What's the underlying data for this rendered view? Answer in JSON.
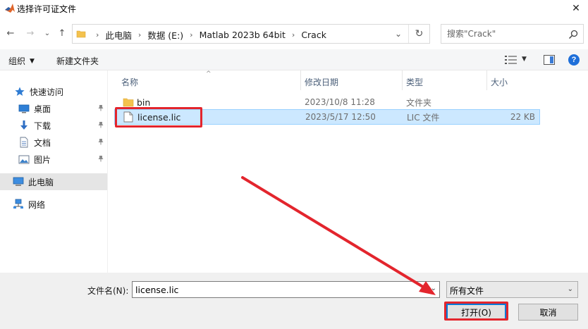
{
  "window": {
    "title": "选择许可证文件",
    "close_glyph": "✕"
  },
  "nav": {
    "back_glyph": "←",
    "forward_glyph": "→",
    "recent_glyph": "⌄",
    "up_glyph": "↑"
  },
  "address": {
    "crumbs": [
      "此电脑",
      "数据 (E:)",
      "Matlab 2023b 64bit",
      "Crack"
    ],
    "separator": "›",
    "dropdown_glyph": "⌄",
    "refresh_glyph": "↻"
  },
  "search": {
    "placeholder": "搜索\"Crack\""
  },
  "toolbar": {
    "organize_label": "组织",
    "organize_caret": "▼",
    "new_folder_label": "新建文件夹",
    "view_caret": "▼",
    "help_glyph": "?"
  },
  "sidebar": {
    "items": [
      {
        "label": "快速访问",
        "icon": "star-icon"
      },
      {
        "label": "桌面",
        "icon": "desktop-icon",
        "pinned": true
      },
      {
        "label": "下载",
        "icon": "download-icon",
        "pinned": true
      },
      {
        "label": "文档",
        "icon": "document-icon",
        "pinned": true
      },
      {
        "label": "图片",
        "icon": "picture-icon",
        "pinned": true
      },
      {
        "label": "此电脑",
        "icon": "computer-icon",
        "selected": true
      },
      {
        "label": "网络",
        "icon": "network-icon"
      }
    ],
    "pin_glyph": "📌"
  },
  "list": {
    "columns": {
      "name": "名称",
      "date": "修改日期",
      "type": "类型",
      "size": "大小"
    },
    "sort_caret": "^",
    "rows": [
      {
        "name": "bin",
        "date": "2023/10/8 11:28",
        "type": "文件夹",
        "size": "",
        "kind": "folder"
      },
      {
        "name": "license.lic",
        "date": "2023/5/17 12:50",
        "type": "LIC 文件",
        "size": "22 KB",
        "kind": "file",
        "selected": true
      }
    ]
  },
  "footer": {
    "filename_label": "文件名(N):",
    "filename_value": "license.lic",
    "dropdown_glyph": "⌄",
    "filetype_value": "所有文件",
    "open_label": "打开(O)",
    "cancel_label": "取消"
  },
  "colors": {
    "accent": "#0078d7",
    "selection": "#cce8ff",
    "annotation": "#e3252d",
    "folder": "#f4c24e"
  }
}
